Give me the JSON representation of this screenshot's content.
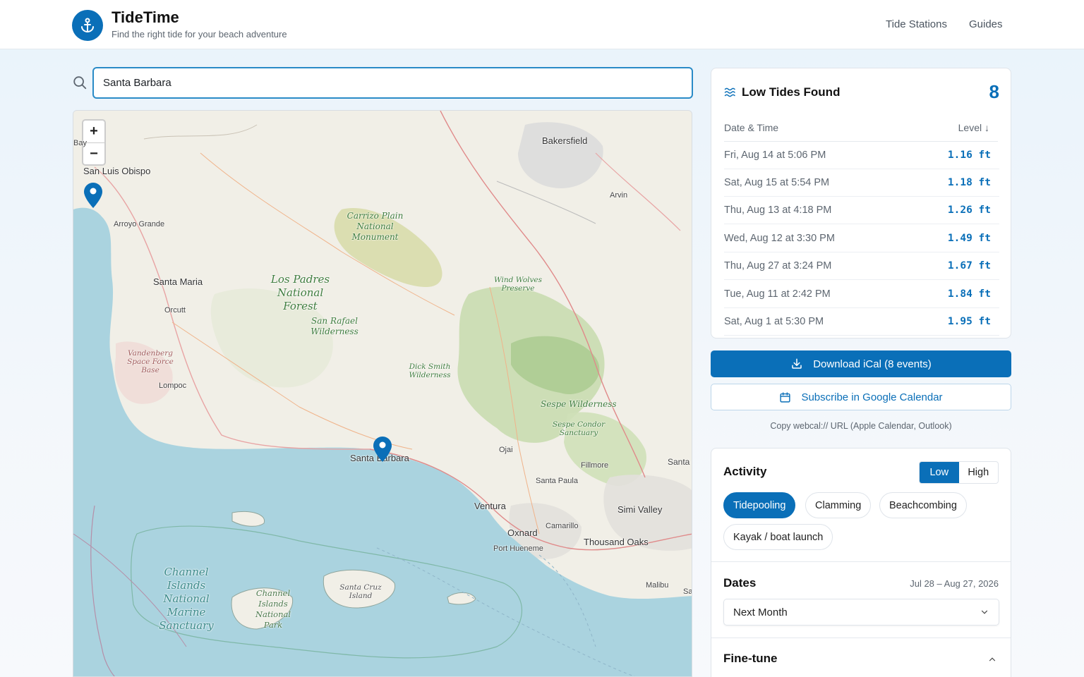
{
  "app": {
    "title": "TideTime",
    "subtitle": "Find the right tide for your beach adventure",
    "accent": "#0a6fb8"
  },
  "nav": [
    {
      "label": "Tide Stations"
    },
    {
      "label": "Guides"
    }
  ],
  "search": {
    "value": "Santa Barbara",
    "icon": "search-icon"
  },
  "map": {
    "zoom_in": "+",
    "zoom_out": "−",
    "labels": {
      "bakersfield": "Bakersfield",
      "arvin": "Arvin",
      "san_luis_obispo": "San Luis Obispo",
      "arroyo_grande": "Arroyo Grande",
      "santa_maria": "Santa Maria",
      "orcutt": "Orcutt",
      "vandenberg": "Vandenberg Space Force Base",
      "lompoc": "Lompoc",
      "carrizo": "Carrizo Plain National Monument",
      "los_padres": "Los Padres National Forest",
      "san_rafael": "San Rafael Wilderness",
      "dick_smith": "Dick Smith Wilderness",
      "wind_wolves": "Wind Wolves Preserve",
      "sespe": "Sespe Wilderness",
      "sespe_condor": "Sespe Condor Sanctuary",
      "santa_barbara": "Santa Barbara",
      "ojai": "Ojai",
      "fillmore": "Fillmore",
      "santa_paula": "Santa Paula",
      "santa_clarita": "Santa",
      "ventura": "Ventura",
      "simi_valley": "Simi Valley",
      "oxnard": "Oxnard",
      "camarillo": "Camarillo",
      "port_hueneme": "Port Hueneme",
      "thousand_oaks": "Thousand Oaks",
      "malibu": "Malibu",
      "channel_sanctuary": "Channel Islands National Marine Sanctuary",
      "channel_park": "Channel Islands National Park",
      "santa_cruz_island": "Santa Cruz Island",
      "bay": "Bay",
      "sa": "Sa"
    }
  },
  "tides": {
    "title": "Low Tides Found",
    "count": "8",
    "col_date": "Date & Time",
    "col_level": "Level ↓",
    "rows": [
      {
        "date": "Fri, Aug 14 at 5:06 PM",
        "level": "1.16 ft"
      },
      {
        "date": "Sat, Aug 15 at 5:54 PM",
        "level": "1.18 ft"
      },
      {
        "date": "Thu, Aug 13 at 4:18 PM",
        "level": "1.26 ft"
      },
      {
        "date": "Wed, Aug 12 at 3:30 PM",
        "level": "1.49 ft"
      },
      {
        "date": "Thu, Aug 27 at 3:24 PM",
        "level": "1.67 ft"
      },
      {
        "date": "Tue, Aug 11 at 2:42 PM",
        "level": "1.84 ft"
      },
      {
        "date": "Sat, Aug 1 at 5:30 PM",
        "level": "1.95 ft"
      }
    ]
  },
  "actions": {
    "download": "Download iCal (8 events)",
    "subscribe": "Subscribe in Google Calendar",
    "webcal": "Copy webcal:// URL (Apple Calendar, Outlook)"
  },
  "activity": {
    "title": "Activity",
    "toggle": {
      "low": "Low",
      "high": "High",
      "selected": "Low"
    },
    "chips": [
      {
        "label": "Tidepooling",
        "active": true
      },
      {
        "label": "Clamming",
        "active": false
      },
      {
        "label": "Beachcombing",
        "active": false
      },
      {
        "label": "Kayak / boat launch",
        "active": false
      }
    ]
  },
  "dates": {
    "title": "Dates",
    "range": "Jul 28 – Aug 27, 2026",
    "selected": "Next Month"
  },
  "finetune": {
    "title": "Fine-tune"
  }
}
